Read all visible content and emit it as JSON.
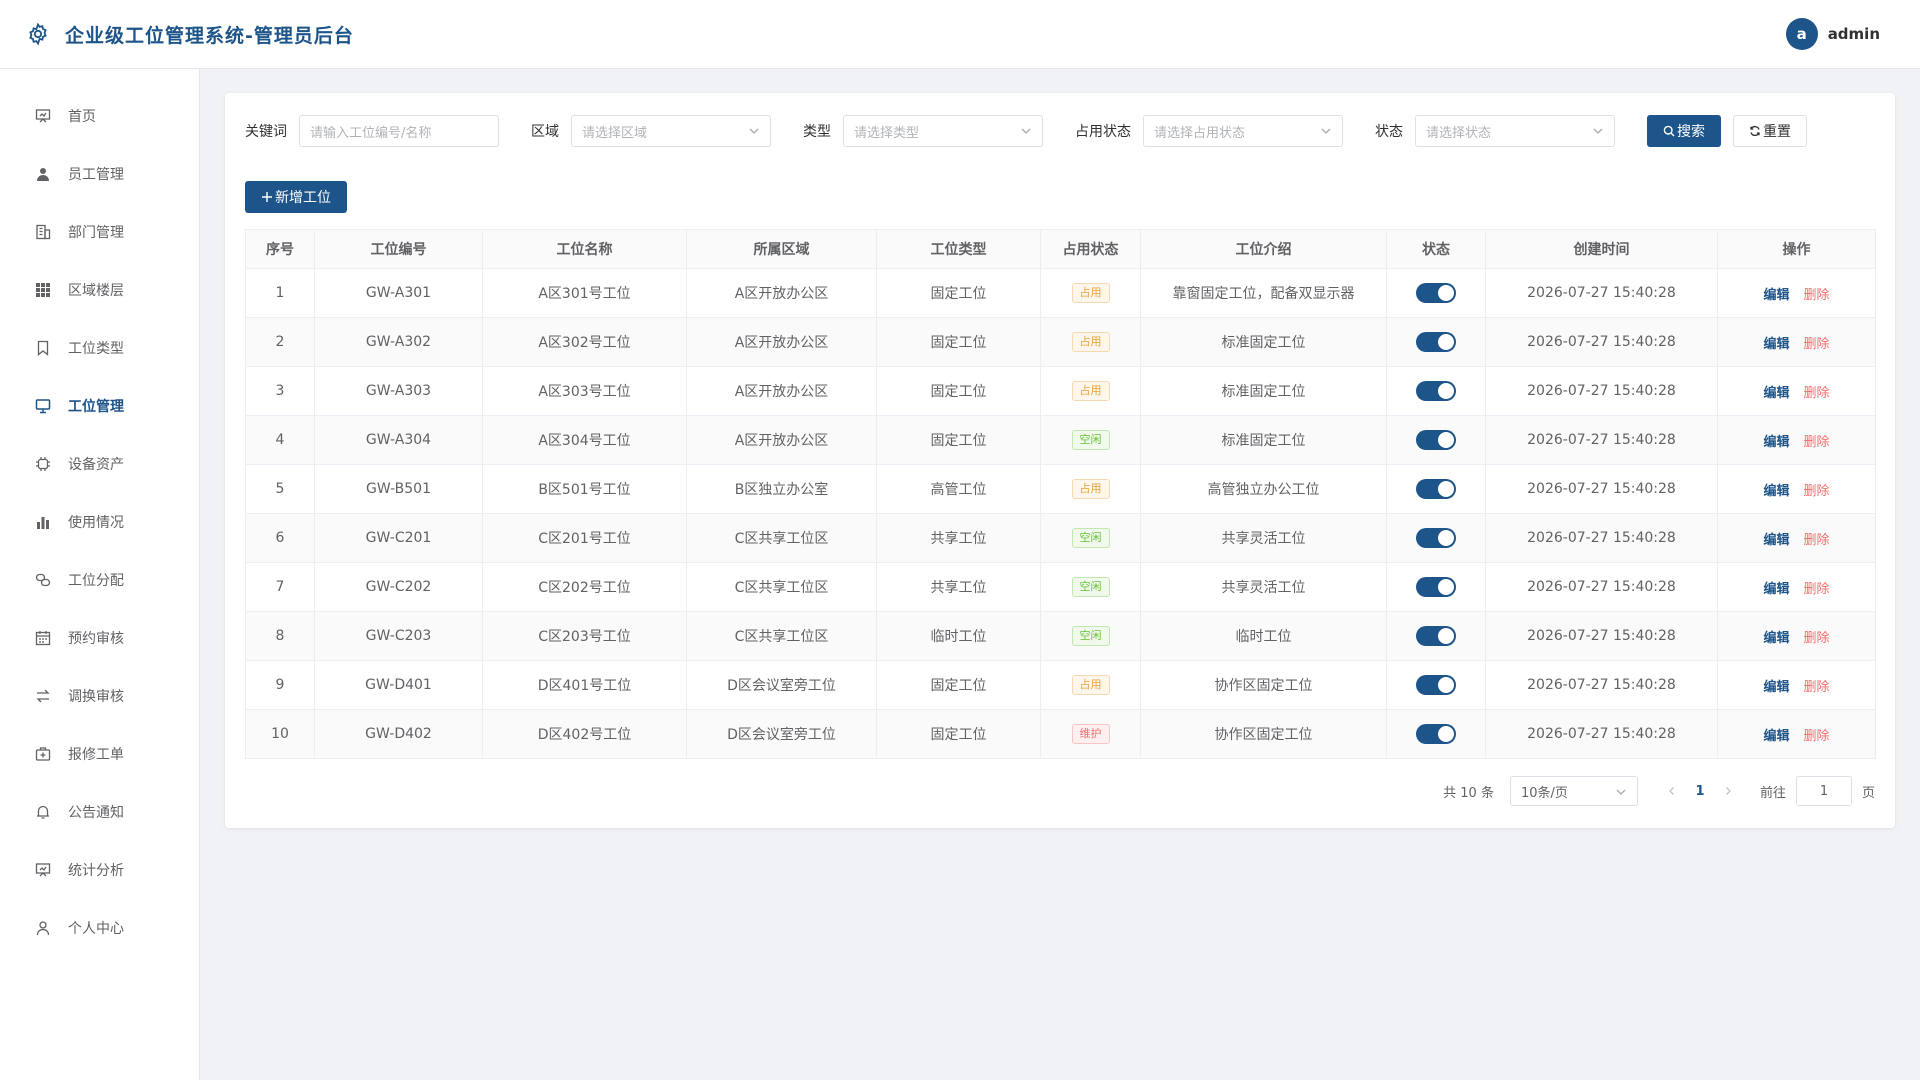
{
  "header": {
    "title": "企业级工位管理系统-管理员后台",
    "avatar_letter": "a",
    "username": "admin"
  },
  "sidebar": {
    "items": [
      {
        "label": "首页",
        "icon": "presentation-icon",
        "active": false
      },
      {
        "label": "员工管理",
        "icon": "user-icon",
        "active": false
      },
      {
        "label": "部门管理",
        "icon": "building-icon",
        "active": false
      },
      {
        "label": "区域楼层",
        "icon": "grid-icon",
        "active": false
      },
      {
        "label": "工位类型",
        "icon": "bookmark-icon",
        "active": false
      },
      {
        "label": "工位管理",
        "icon": "monitor-icon",
        "active": true
      },
      {
        "label": "设备资产",
        "icon": "cpu-icon",
        "active": false
      },
      {
        "label": "使用情况",
        "icon": "bar-chart-icon",
        "active": false
      },
      {
        "label": "工位分配",
        "icon": "connection-icon",
        "active": false
      },
      {
        "label": "预约审核",
        "icon": "calendar-icon",
        "active": false
      },
      {
        "label": "调换审核",
        "icon": "switch-icon",
        "active": false
      },
      {
        "label": "报修工单",
        "icon": "first-aid-icon",
        "active": false
      },
      {
        "label": "公告通知",
        "icon": "bell-icon",
        "active": false
      },
      {
        "label": "统计分析",
        "icon": "data-board-icon",
        "active": false
      },
      {
        "label": "个人中心",
        "icon": "person-icon",
        "active": false
      }
    ]
  },
  "filters": {
    "keyword_label": "关键词",
    "keyword_placeholder": "请输入工位编号/名称",
    "area_label": "区域",
    "area_placeholder": "请选择区域",
    "type_label": "类型",
    "type_placeholder": "请选择类型",
    "occupy_label": "占用状态",
    "occupy_placeholder": "请选择占用状态",
    "status_label": "状态",
    "status_placeholder": "请选择状态",
    "search_label": "搜索",
    "reset_label": "重置"
  },
  "add_button_label": "新增工位",
  "table": {
    "columns": [
      "序号",
      "工位编号",
      "工位名称",
      "所属区域",
      "工位类型",
      "占用状态",
      "工位介绍",
      "状态",
      "创建时间",
      "操作"
    ],
    "edit_label": "编辑",
    "delete_label": "删除",
    "rows": [
      {
        "no": "1",
        "code": "GW-A301",
        "name": "A区301号工位",
        "area": "A区开放办公区",
        "type": "固定工位",
        "occupy": "占用",
        "occupy_kind": "occupied",
        "desc": "靠窗固定工位，配备双显示器",
        "enabled": true,
        "created": "2026-07-27 15:40:28"
      },
      {
        "no": "2",
        "code": "GW-A302",
        "name": "A区302号工位",
        "area": "A区开放办公区",
        "type": "固定工位",
        "occupy": "占用",
        "occupy_kind": "occupied",
        "desc": "标准固定工位",
        "enabled": true,
        "created": "2026-07-27 15:40:28"
      },
      {
        "no": "3",
        "code": "GW-A303",
        "name": "A区303号工位",
        "area": "A区开放办公区",
        "type": "固定工位",
        "occupy": "占用",
        "occupy_kind": "occupied",
        "desc": "标准固定工位",
        "enabled": true,
        "created": "2026-07-27 15:40:28"
      },
      {
        "no": "4",
        "code": "GW-A304",
        "name": "A区304号工位",
        "area": "A区开放办公区",
        "type": "固定工位",
        "occupy": "空闲",
        "occupy_kind": "free",
        "desc": "标准固定工位",
        "enabled": true,
        "created": "2026-07-27 15:40:28"
      },
      {
        "no": "5",
        "code": "GW-B501",
        "name": "B区501号工位",
        "area": "B区独立办公室",
        "type": "高管工位",
        "occupy": "占用",
        "occupy_kind": "occupied",
        "desc": "高管独立办公工位",
        "enabled": true,
        "created": "2026-07-27 15:40:28"
      },
      {
        "no": "6",
        "code": "GW-C201",
        "name": "C区201号工位",
        "area": "C区共享工位区",
        "type": "共享工位",
        "occupy": "空闲",
        "occupy_kind": "free",
        "desc": "共享灵活工位",
        "enabled": true,
        "created": "2026-07-27 15:40:28"
      },
      {
        "no": "7",
        "code": "GW-C202",
        "name": "C区202号工位",
        "area": "C区共享工位区",
        "type": "共享工位",
        "occupy": "空闲",
        "occupy_kind": "free",
        "desc": "共享灵活工位",
        "enabled": true,
        "created": "2026-07-27 15:40:28"
      },
      {
        "no": "8",
        "code": "GW-C203",
        "name": "C区203号工位",
        "area": "C区共享工位区",
        "type": "临时工位",
        "occupy": "空闲",
        "occupy_kind": "free",
        "desc": "临时工位",
        "enabled": true,
        "created": "2026-07-27 15:40:28"
      },
      {
        "no": "9",
        "code": "GW-D401",
        "name": "D区401号工位",
        "area": "D区会议室旁工位",
        "type": "固定工位",
        "occupy": "占用",
        "occupy_kind": "occupied",
        "desc": "协作区固定工位",
        "enabled": true,
        "created": "2026-07-27 15:40:28"
      },
      {
        "no": "10",
        "code": "GW-D402",
        "name": "D区402号工位",
        "area": "D区会议室旁工位",
        "type": "固定工位",
        "occupy": "维护",
        "occupy_kind": "maint",
        "desc": "协作区固定工位",
        "enabled": true,
        "created": "2026-07-27 15:40:28"
      }
    ]
  },
  "pagination": {
    "total_text": "共 10 条",
    "page_size": "10条/页",
    "current_page": "1",
    "goto_label": "前往",
    "goto_value": "1",
    "page_suffix": "页"
  },
  "colors": {
    "primary": "#1d5489",
    "occupied": "#e6a23c",
    "free": "#67c23a",
    "maint": "#f56c6c"
  }
}
